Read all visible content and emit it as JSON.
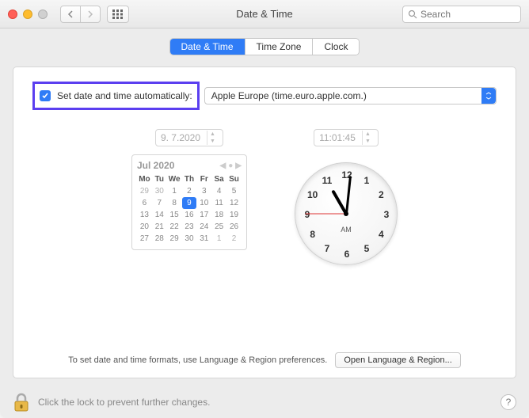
{
  "window": {
    "title": "Date & Time",
    "search_placeholder": "Search"
  },
  "tabs": {
    "date_time": "Date & Time",
    "time_zone": "Time Zone",
    "clock": "Clock"
  },
  "auto": {
    "label": "Set date and time automatically:",
    "checked": true,
    "server": "Apple Europe (time.euro.apple.com.)"
  },
  "date_field": "9.  7.2020",
  "time_field": "11:01:45",
  "calendar": {
    "month_label": "Jul 2020",
    "weekdays": [
      "Mo",
      "Tu",
      "We",
      "Th",
      "Fr",
      "Sa",
      "Su"
    ],
    "leading_days": [
      29,
      30
    ],
    "days_in_month": 31,
    "trailing_days": [
      1,
      2
    ],
    "selected_day": 9
  },
  "clock": {
    "ampm": "AM",
    "hour": 11,
    "minute": 1,
    "second": 45
  },
  "bottom": {
    "hint": "To set date and time formats, use Language & Region preferences.",
    "button": "Open Language & Region..."
  },
  "footer": {
    "lock_text": "Click the lock to prevent further changes."
  }
}
